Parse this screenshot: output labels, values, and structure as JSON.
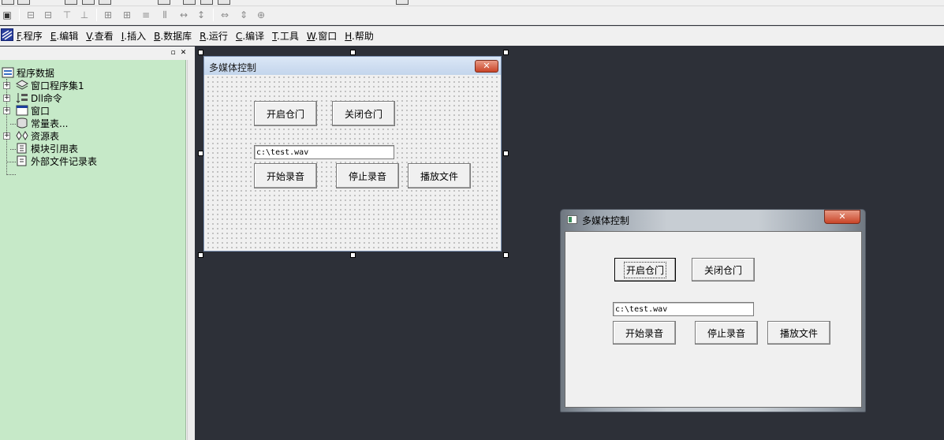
{
  "menu": {
    "items": [
      {
        "key": "F",
        "label": ".程序"
      },
      {
        "key": "E",
        "label": ".编辑"
      },
      {
        "key": "V",
        "label": ".查看"
      },
      {
        "key": "I",
        "label": ".插入"
      },
      {
        "key": "B",
        "label": ".数据库"
      },
      {
        "key": "R",
        "label": ".运行"
      },
      {
        "key": "C",
        "label": ".编译"
      },
      {
        "key": "T",
        "label": ".工具"
      },
      {
        "key": "W",
        "label": ".窗口"
      },
      {
        "key": "H",
        "label": ".帮助"
      }
    ]
  },
  "panel": {
    "tree": {
      "root": "程序数据",
      "items": [
        {
          "label": "窗口程序集1",
          "icon": "module-icon",
          "expandable": true
        },
        {
          "label": "Dll命令",
          "icon": "dll-icon",
          "expandable": true
        },
        {
          "label": "窗口",
          "icon": "window-icon",
          "expandable": true
        },
        {
          "label": "常量表...",
          "icon": "constant-icon",
          "expandable": false
        },
        {
          "label": "资源表",
          "icon": "resource-icon",
          "expandable": true
        },
        {
          "label": "模块引用表",
          "icon": "module-ref-icon",
          "expandable": false
        },
        {
          "label": "外部文件记录表",
          "icon": "file-record-icon",
          "expandable": false
        }
      ]
    }
  },
  "design_form": {
    "title": "多媒体控制",
    "buttons": {
      "open_door": "开启仓门",
      "close_door": "关闭仓门",
      "start_record": "开始录音",
      "stop_record": "停止录音",
      "play_file": "播放文件"
    },
    "file_path": "c:\\test.wav"
  },
  "run_window": {
    "title": "多媒体控制",
    "buttons": {
      "open_door": "开启仓门",
      "close_door": "关闭仓门",
      "start_record": "开始录音",
      "stop_record": "停止录音",
      "play_file": "播放文件"
    },
    "file_path": "c:\\test.wav"
  },
  "colors": {
    "tree_background": "#c6e9c8",
    "workspace_background": "#2d3038",
    "close_button": "#c94528"
  }
}
